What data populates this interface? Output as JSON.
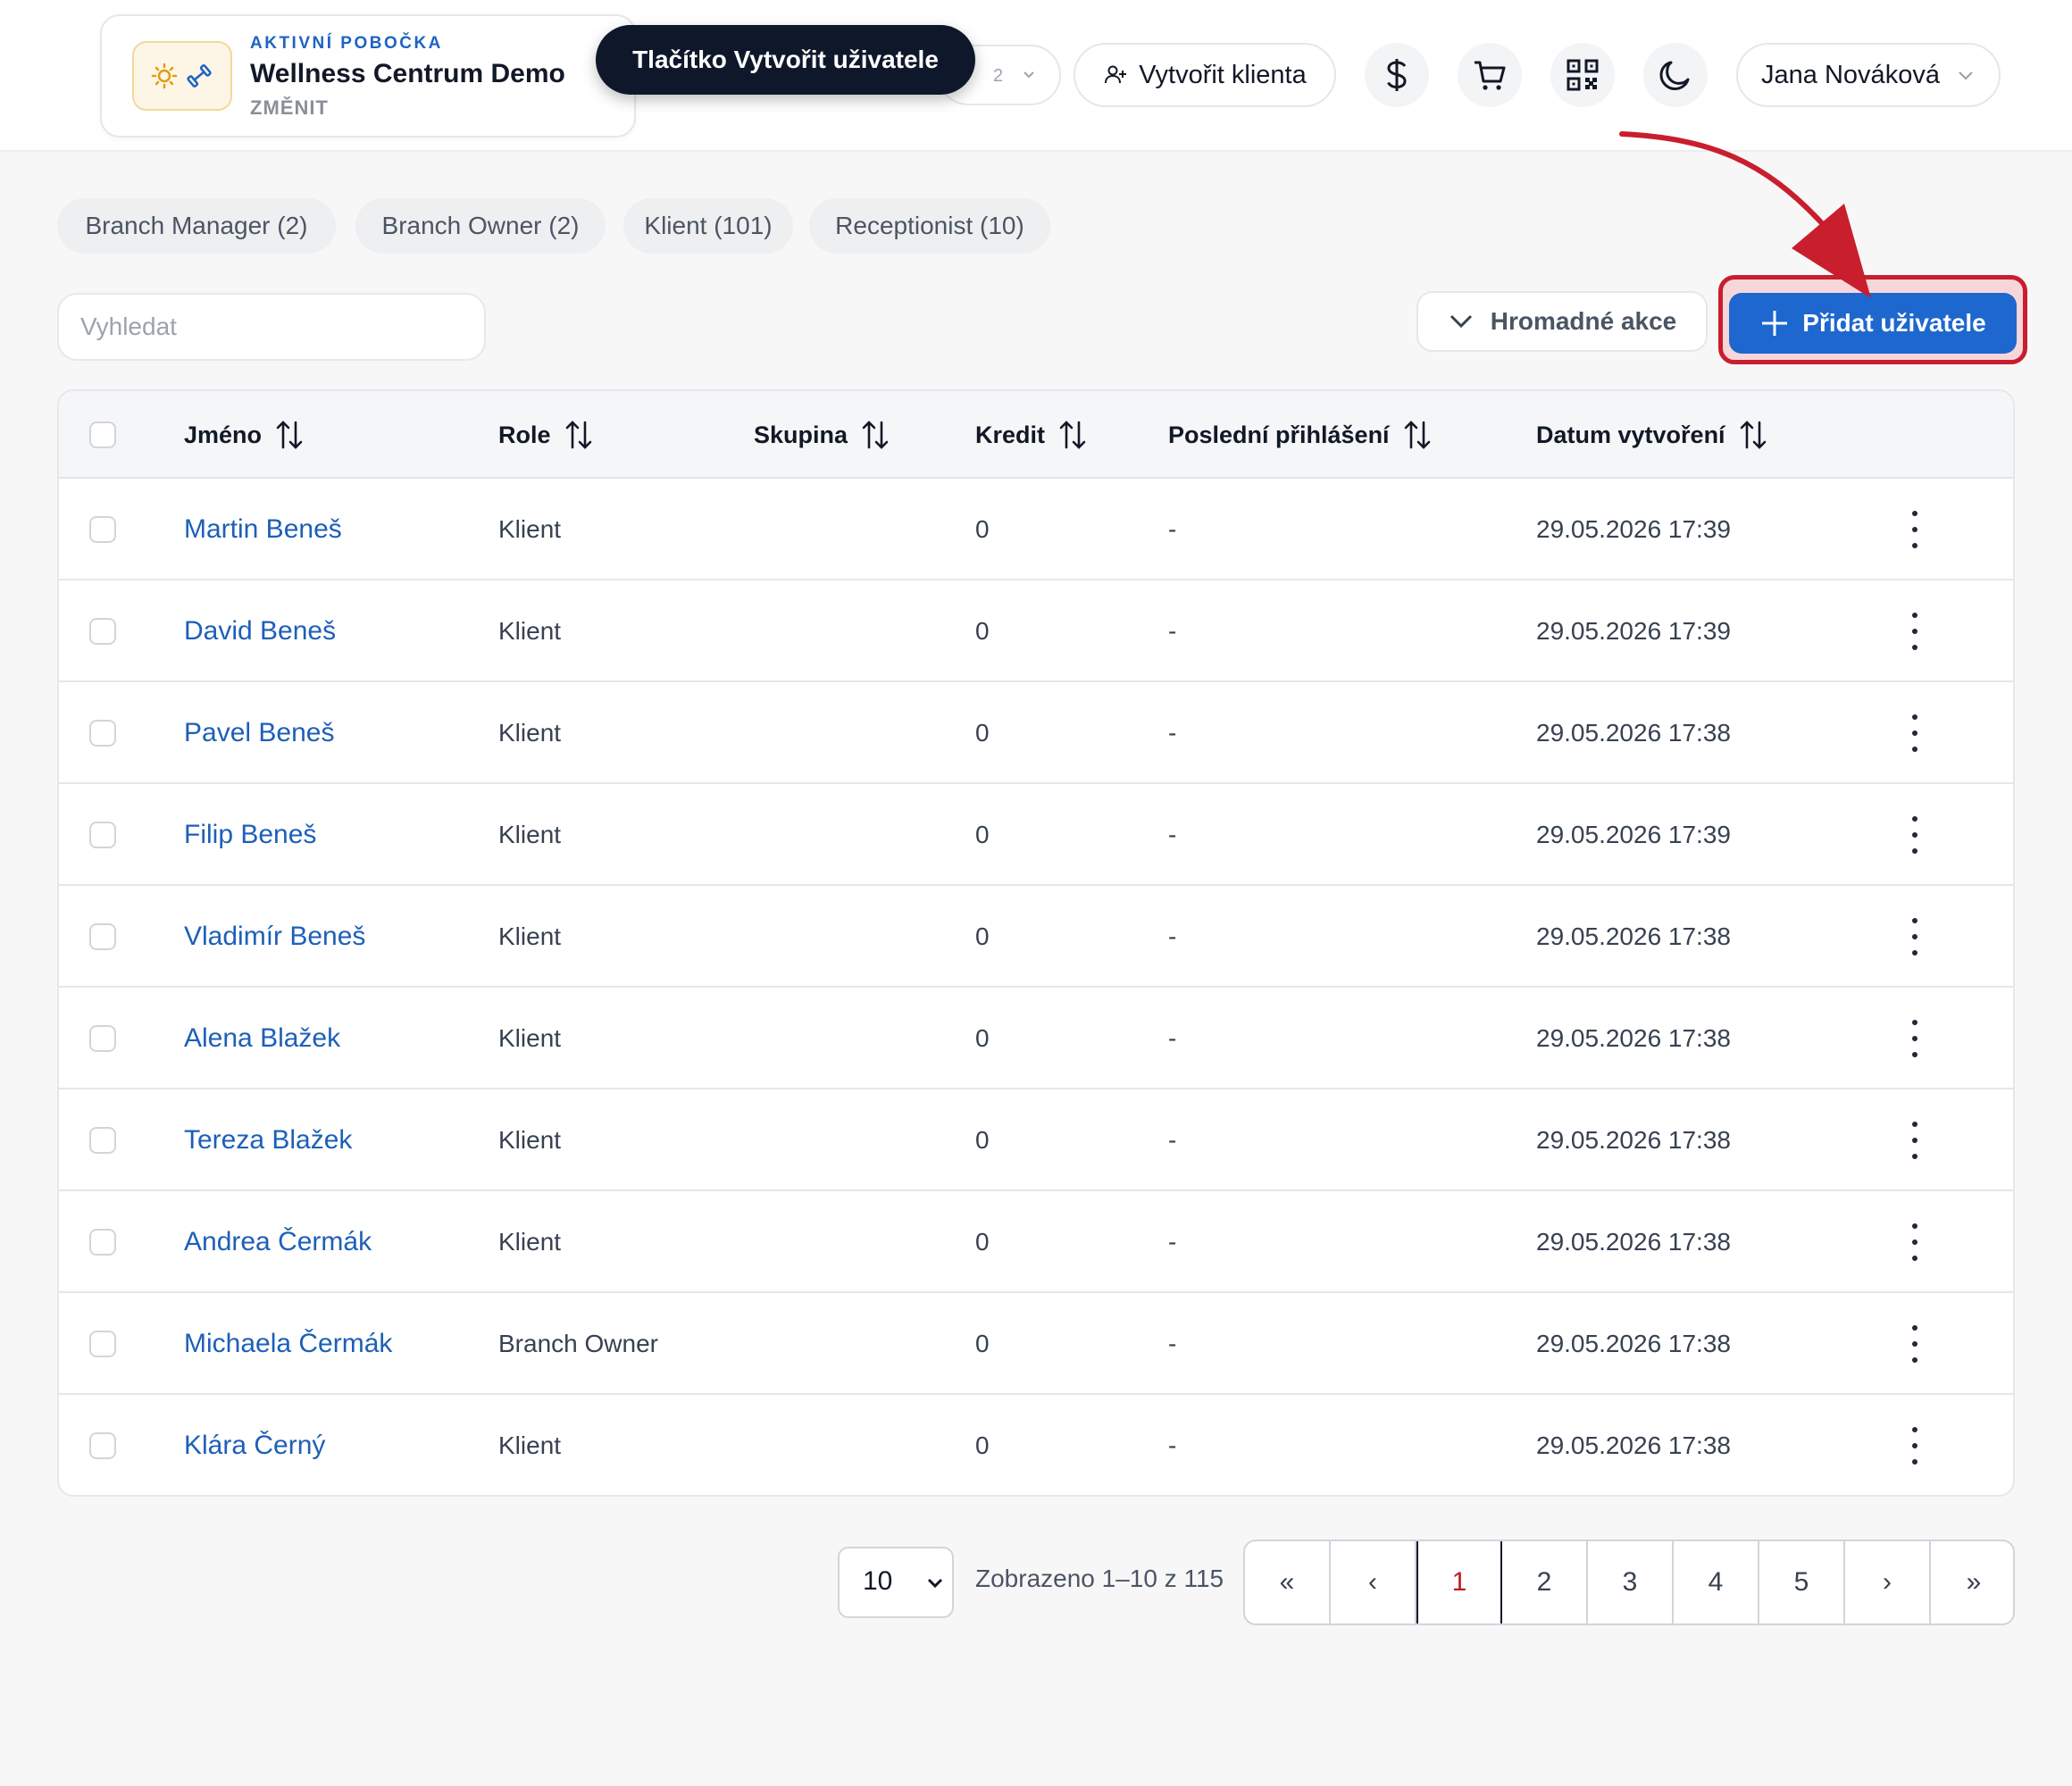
{
  "branch": {
    "kicker": "AKTIVNÍ POBOČKA",
    "name": "Wellness Centrum Demo",
    "change": "ZMĚNIT"
  },
  "tooltip": "Tlačítko Vytvořit uživatele",
  "hidden_select": {
    "value": "2"
  },
  "header": {
    "create_client": "Vytvořit klienta",
    "user_name": "Jana Nováková",
    "icons": [
      "dollar-icon",
      "cart-icon",
      "qr-code-icon",
      "moon-icon"
    ]
  },
  "filters": [
    "Branch Manager (2)",
    "Branch Owner (2)",
    "Klient (101)",
    "Receptionist (10)"
  ],
  "search": {
    "placeholder": "Vyhledat",
    "value": ""
  },
  "actions": {
    "bulk": "Hromadné akce",
    "add_user": "Přidat uživatele"
  },
  "table": {
    "columns": [
      "Jméno",
      "Role",
      "Skupina",
      "Kredit",
      "Poslední přihlášení",
      "Datum vytvoření"
    ],
    "rows": [
      {
        "name": "Martin Beneš",
        "role": "Klient",
        "group": "",
        "credit": "0",
        "last_login": "-",
        "created": "29.05.2026 17:39"
      },
      {
        "name": "David Beneš",
        "role": "Klient",
        "group": "",
        "credit": "0",
        "last_login": "-",
        "created": "29.05.2026 17:39"
      },
      {
        "name": "Pavel Beneš",
        "role": "Klient",
        "group": "",
        "credit": "0",
        "last_login": "-",
        "created": "29.05.2026 17:38"
      },
      {
        "name": "Filip Beneš",
        "role": "Klient",
        "group": "",
        "credit": "0",
        "last_login": "-",
        "created": "29.05.2026 17:39"
      },
      {
        "name": "Vladimír Beneš",
        "role": "Klient",
        "group": "",
        "credit": "0",
        "last_login": "-",
        "created": "29.05.2026 17:38"
      },
      {
        "name": "Alena Blažek",
        "role": "Klient",
        "group": "",
        "credit": "0",
        "last_login": "-",
        "created": "29.05.2026 17:38"
      },
      {
        "name": "Tereza Blažek",
        "role": "Klient",
        "group": "",
        "credit": "0",
        "last_login": "-",
        "created": "29.05.2026 17:38"
      },
      {
        "name": "Andrea Čermák",
        "role": "Klient",
        "group": "",
        "credit": "0",
        "last_login": "-",
        "created": "29.05.2026 17:38"
      },
      {
        "name": "Michaela Čermák",
        "role": "Branch Owner",
        "group": "",
        "credit": "0",
        "last_login": "-",
        "created": "29.05.2026 17:38"
      },
      {
        "name": "Klára Černý",
        "role": "Klient",
        "group": "",
        "credit": "0",
        "last_login": "-",
        "created": "29.05.2026 17:38"
      }
    ]
  },
  "pagination": {
    "per_page": "10",
    "info": "Zobrazeno 1–10 z 115",
    "first": "«",
    "prev": "‹",
    "pages": [
      "1",
      "2",
      "3",
      "4",
      "5"
    ],
    "current": "1",
    "next": "›",
    "last": "»"
  },
  "colors": {
    "accent": "#1d67cf",
    "highlight": "#c81e2e",
    "link": "#1d5fb8",
    "tooltip_bg": "#0f172a"
  }
}
